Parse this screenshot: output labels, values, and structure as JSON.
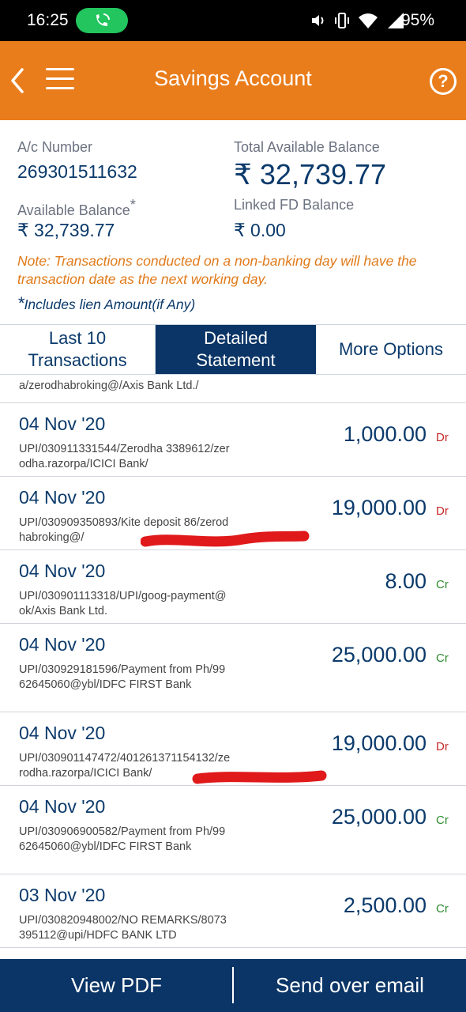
{
  "status_bar": {
    "time": "16:25",
    "battery": "95%",
    "icons": [
      "call-active-icon",
      "volume-icon",
      "vibrate-icon",
      "wifi-icon",
      "signal-icon"
    ]
  },
  "header": {
    "title": "Savings Account",
    "back_icon": "chevron-left-icon",
    "menu_icon": "hamburger-menu-icon",
    "help_label": "?"
  },
  "account": {
    "ac_number_label": "A/c Number",
    "ac_number": "269301511632",
    "total_balance_label": "Total Available Balance",
    "total_balance": "₹ 32,739.77",
    "available_balance_label": "Available Balance",
    "available_balance_mark": "*",
    "available_balance": "₹ 32,739.77",
    "linked_fd_label": "Linked FD Balance",
    "linked_fd": "₹ 0.00",
    "note": "Note: Transactions conducted on a non-banking day will have the transaction date as the next working day.",
    "lien_mark": "*",
    "lien_note": "Includes lien Amount(if Any)"
  },
  "tabs": [
    {
      "label": "Last 10 Transactions",
      "active": false
    },
    {
      "label": "Detailed Statement",
      "active": true
    },
    {
      "label": "More Options",
      "active": false
    }
  ],
  "transactions_top_fragment": "a/zerodhabroking@/Axis Bank Ltd./",
  "transactions": [
    {
      "date": "04 Nov '20",
      "desc": "UPI/030911331544/Zerodha 3389612/zerodha.razorpa/ICICI Bank/",
      "amount": "1,000.00",
      "type": "Dr"
    },
    {
      "date": "04 Nov '20",
      "desc": "UPI/030909350893/Kite deposit 86/zerodhabroking@/",
      "amount": "19,000.00",
      "type": "Dr"
    },
    {
      "date": "04 Nov '20",
      "desc": "UPI/030901113318/UPI/goog-payment@ok/Axis Bank Ltd.",
      "amount": "8.00",
      "type": "Cr"
    },
    {
      "date": "04 Nov '20",
      "desc": "UPI/030929181596/Payment from Ph/9962645060@ybl/IDFC FIRST Bank",
      "amount": "25,000.00",
      "type": "Cr"
    },
    {
      "date": "04 Nov '20",
      "desc": "UPI/030901147472/401261371154132/zerodha.razorpa/ICICI Bank/",
      "amount": "19,000.00",
      "type": "Dr"
    },
    {
      "date": "04 Nov '20",
      "desc": "UPI/030906900582/Payment from Ph/9962645060@ybl/IDFC FIRST Bank",
      "amount": "25,000.00",
      "type": "Cr"
    },
    {
      "date": "03 Nov '20",
      "desc": "UPI/030820948002/NO REMARKS/8073395112@upi/HDFC BANK LTD",
      "amount": "2,500.00",
      "type": "Cr"
    }
  ],
  "bottom_bar": {
    "view_pdf": "View PDF",
    "send_email": "Send over email"
  },
  "colors": {
    "header": "#ea7d1b",
    "navy": "#0b3566",
    "debit": "#c62828",
    "credit": "#2e8b2e",
    "annotation": "#e0191b"
  }
}
